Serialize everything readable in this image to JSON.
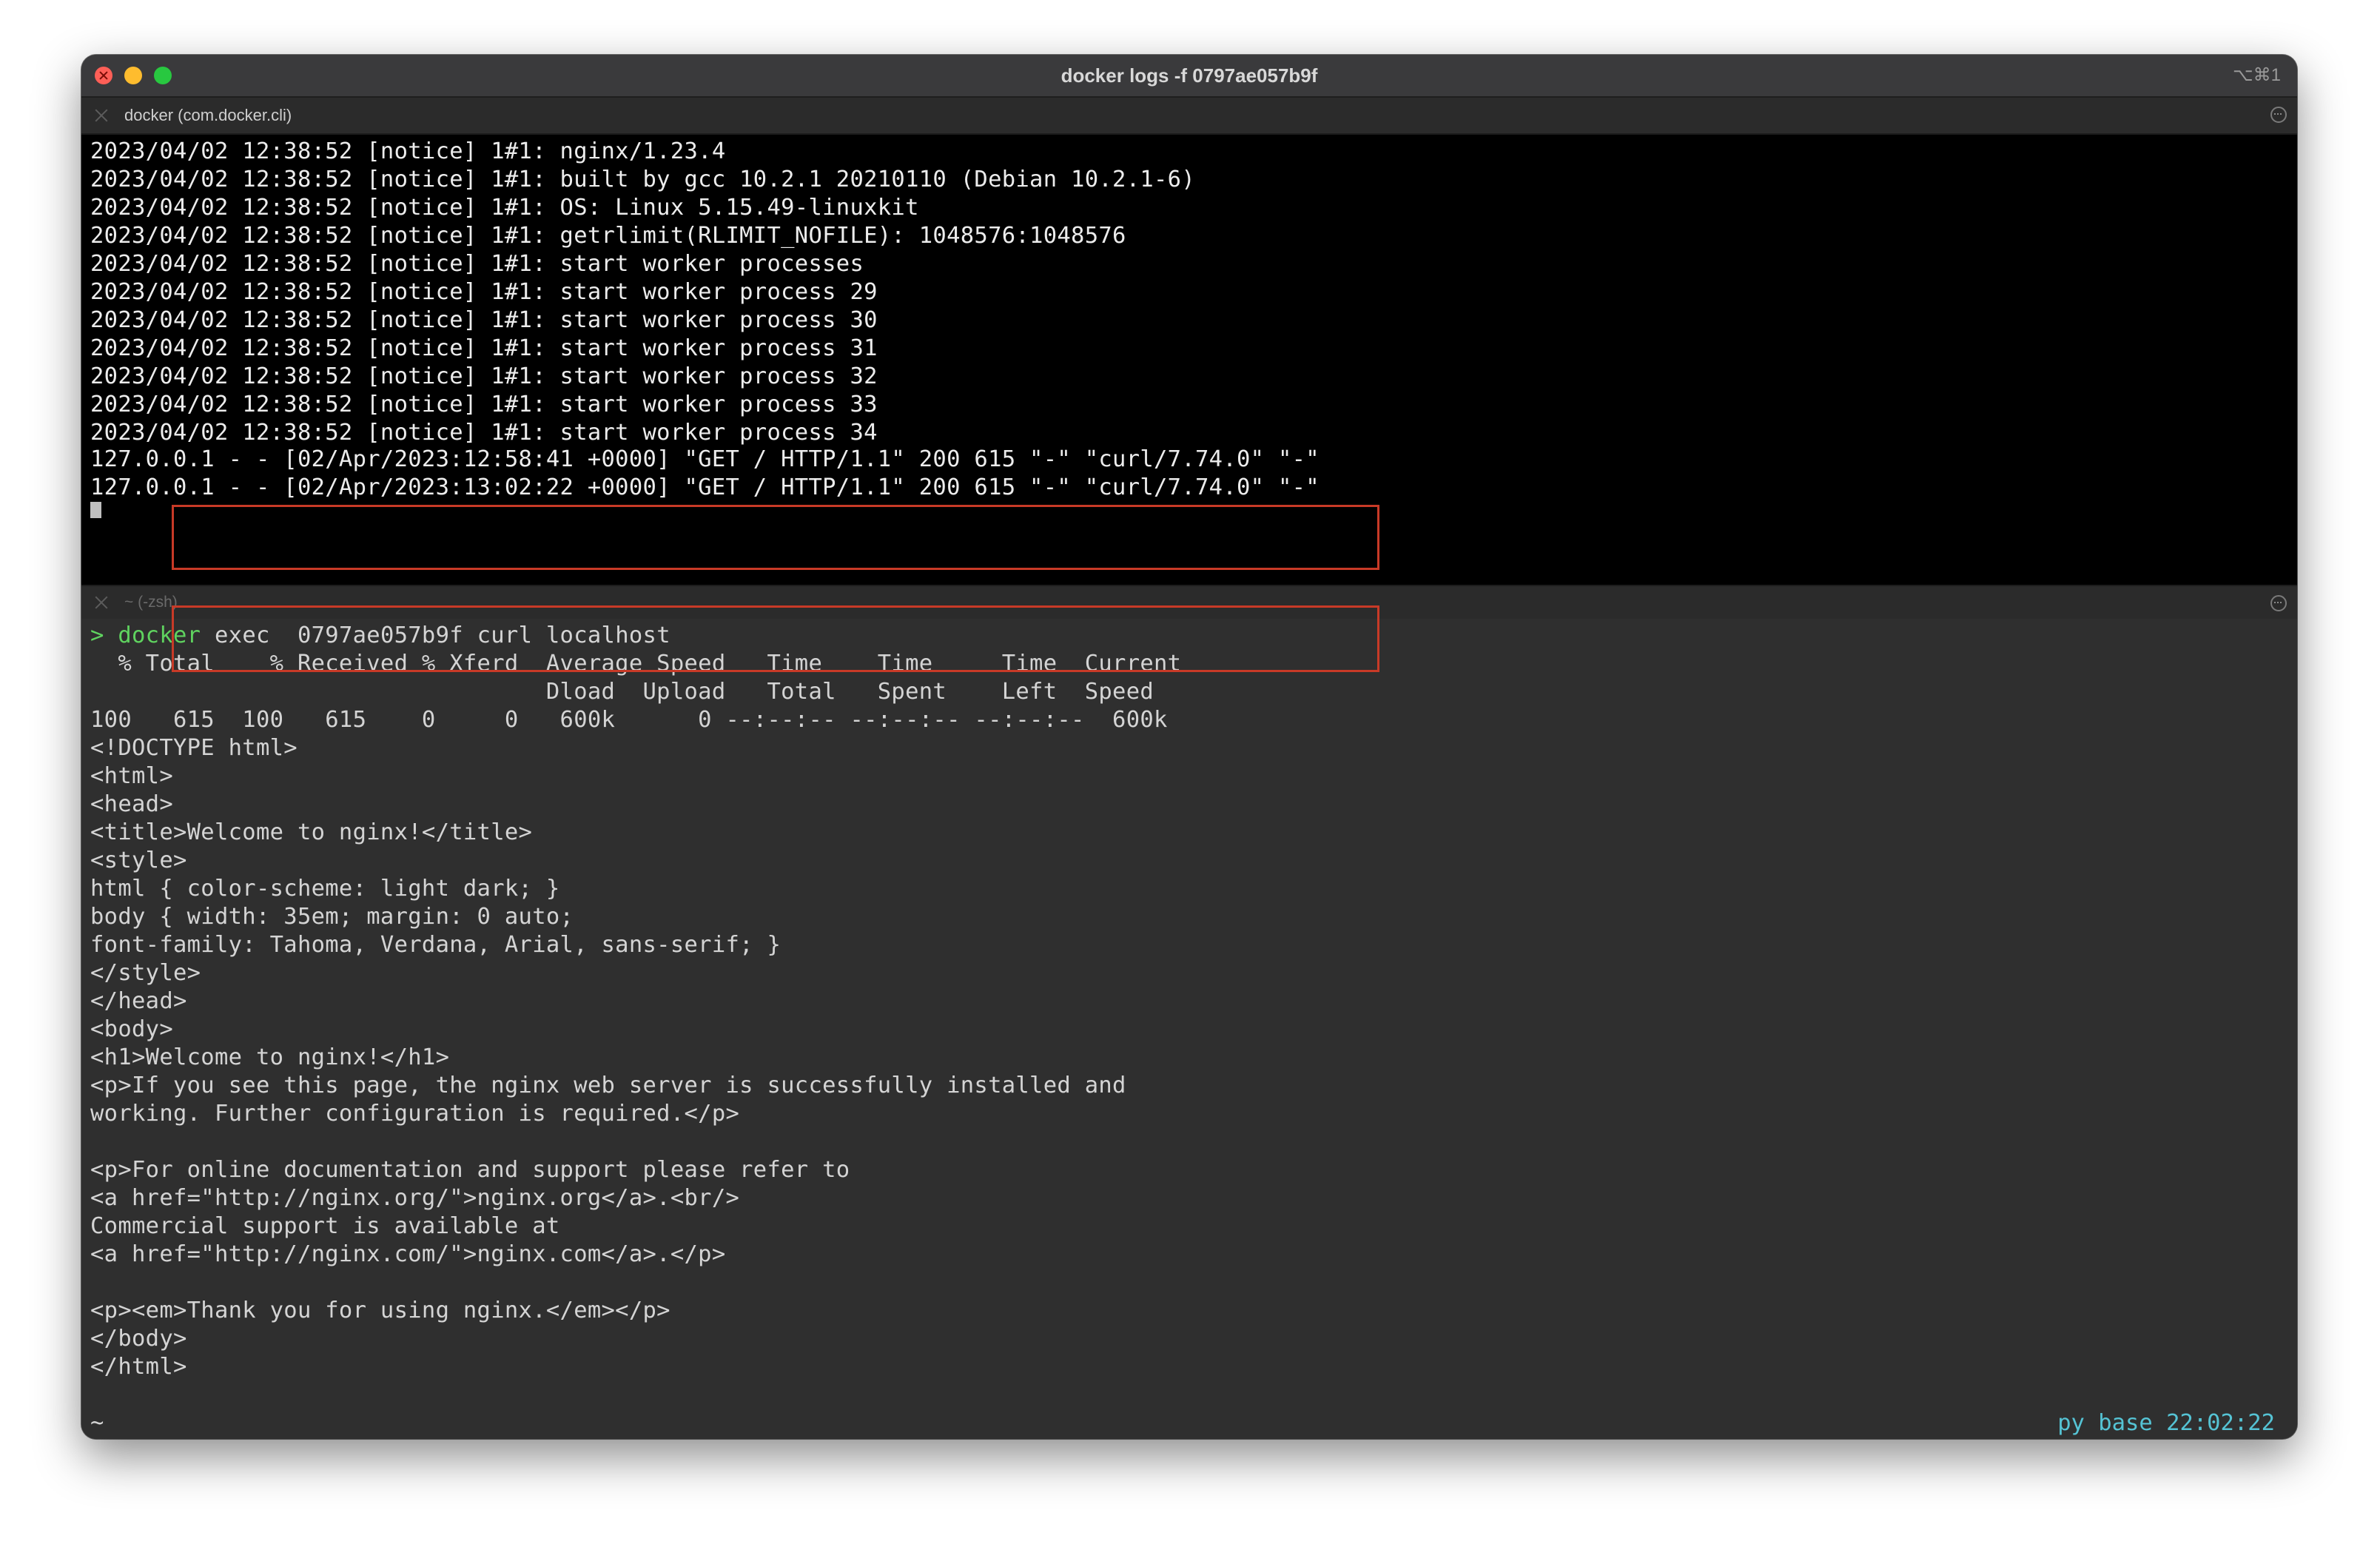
{
  "window": {
    "title": "docker logs -f 0797ae057b9f",
    "shortcut": "⌥⌘1"
  },
  "pane1": {
    "title": "docker (com.docker.cli)",
    "lines": [
      "2023/04/02 12:38:52 [notice] 1#1: nginx/1.23.4",
      "2023/04/02 12:38:52 [notice] 1#1: built by gcc 10.2.1 20210110 (Debian 10.2.1-6)",
      "2023/04/02 12:38:52 [notice] 1#1: OS: Linux 5.15.49-linuxkit",
      "2023/04/02 12:38:52 [notice] 1#1: getrlimit(RLIMIT_NOFILE): 1048576:1048576",
      "2023/04/02 12:38:52 [notice] 1#1: start worker processes",
      "2023/04/02 12:38:52 [notice] 1#1: start worker process 29",
      "2023/04/02 12:38:52 [notice] 1#1: start worker process 30",
      "2023/04/02 12:38:52 [notice] 1#1: start worker process 31",
      "2023/04/02 12:38:52 [notice] 1#1: start worker process 32",
      "2023/04/02 12:38:52 [notice] 1#1: start worker process 33",
      "2023/04/02 12:38:52 [notice] 1#1: start worker process 34"
    ],
    "access_lines": [
      "127.0.0.1 - - [02/Apr/2023:12:58:41 +0000] \"GET / HTTP/1.1\" 200 615 \"-\" \"curl/7.74.0\" \"-\"",
      "127.0.0.1 - - [02/Apr/2023:13:02:22 +0000] \"GET / HTTP/1.1\" 200 615 \"-\" \"curl/7.74.0\" \"-\""
    ]
  },
  "pane2": {
    "title": "~ (-zsh)",
    "prompt_symbol": ">",
    "command_word": "docker",
    "command_rest": " exec  0797ae057b9f curl localhost",
    "output": [
      "  % Total    % Received % Xferd  Average Speed   Time    Time     Time  Current",
      "                                 Dload  Upload   Total   Spent    Left  Speed",
      "100   615  100   615    0     0   600k      0 --:--:-- --:--:-- --:--:--  600k",
      "<!DOCTYPE html>",
      "<html>",
      "<head>",
      "<title>Welcome to nginx!</title>",
      "<style>",
      "html { color-scheme: light dark; }",
      "body { width: 35em; margin: 0 auto;",
      "font-family: Tahoma, Verdana, Arial, sans-serif; }",
      "</style>",
      "</head>",
      "<body>",
      "<h1>Welcome to nginx!</h1>",
      "<p>If you see this page, the nginx web server is successfully installed and",
      "working. Further configuration is required.</p>",
      "",
      "<p>For online documentation and support please refer to",
      "<a href=\"http://nginx.org/\">nginx.org</a>.<br/>",
      "Commercial support is available at",
      "<a href=\"http://nginx.com/\">nginx.com</a>.</p>",
      "",
      "<p><em>Thank you for using nginx.</em></p>",
      "</body>",
      "</html>"
    ],
    "cwd": "~",
    "right_status": "py base 22:02:22"
  },
  "colors": {
    "annotation": "#c83a27",
    "prompt_green": "#5fd35f",
    "status_cyan": "#55c3d4"
  }
}
